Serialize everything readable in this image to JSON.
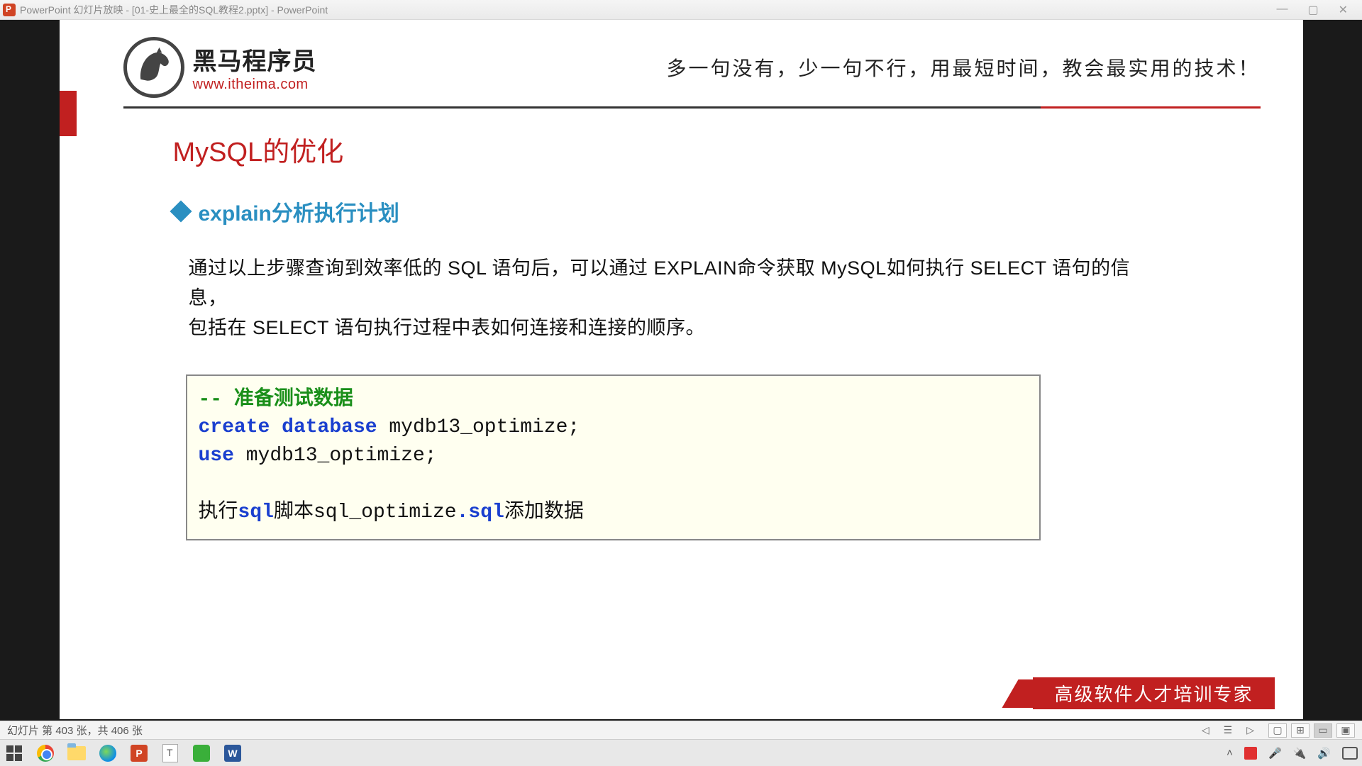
{
  "titlebar": {
    "text": "PowerPoint 幻灯片放映 - [01-史上最全的SQL教程2.pptx] - PowerPoint"
  },
  "slide": {
    "logo_main": "黑马程序员",
    "logo_url": "www.itheima.com",
    "slogan": "多一句没有，少一句不行，用最短时间，教会最实用的技术！",
    "title": "MySQL的优化",
    "subtitle": "explain分析执行计划",
    "body_l1": "通过以上步骤查询到效率低的 SQL 语句后，可以通过 EXPLAIN命令获取 MySQL如何执行 SELECT 语句的信息，",
    "body_l2": "包括在 SELECT 语句执行过程中表如何连接和连接的顺序。",
    "code": {
      "comment_dashes": "-- ",
      "comment_text": "准备测试数据",
      "kw_create": "create",
      "kw_database": "database",
      "db_name": " mydb13_optimize;",
      "kw_use": "use",
      "use_tail": " mydb13_optimize;",
      "exec_prefix": "执行",
      "exec_sql1": "sql",
      "exec_mid1": "脚本",
      "exec_file_a": "sql_optimize",
      "exec_dot": ".",
      "exec_file_b": "sql",
      "exec_suffix": "添加数据"
    },
    "footer_banner": "高级软件人才培训专家"
  },
  "statusbar": {
    "slide_counter": "幻灯片 第 403 张，共 406 张"
  },
  "taskbar_apps": {
    "ppt": "P",
    "word": "W"
  }
}
